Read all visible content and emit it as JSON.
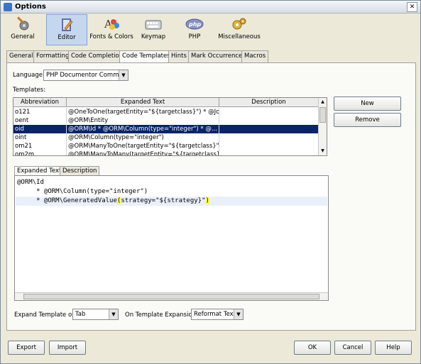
{
  "window": {
    "title": "Options",
    "close_glyph": "✕"
  },
  "categories": [
    {
      "label": "General",
      "icon": "wrench-gear-icon"
    },
    {
      "label": "Editor",
      "icon": "editor-pencil-icon",
      "selected": true
    },
    {
      "label": "Fonts & Colors",
      "icon": "fonts-colors-icon"
    },
    {
      "label": "Keymap",
      "icon": "keyboard-icon"
    },
    {
      "label": "PHP",
      "icon": "php-icon"
    },
    {
      "label": "Miscellaneous",
      "icon": "misc-gears-icon"
    }
  ],
  "tabs": [
    "General",
    "Formatting",
    "Code Completion",
    "Code Templates",
    "Hints",
    "Mark Occurrences",
    "Macros"
  ],
  "active_tab": "Code Templates",
  "language": {
    "label": "Language:",
    "value": "PHP Documentor Comment"
  },
  "templates_label": "Templates:",
  "table": {
    "columns": [
      "Abbreviation",
      "Expanded Text",
      "Description"
    ],
    "rows": [
      {
        "abbr": "o121",
        "text": "@OneToOne(targetEntity=\"${targetclass}\")   * @Join...",
        "desc": ""
      },
      {
        "abbr": "oent",
        "text": "@ORM\\Entity",
        "desc": ""
      },
      {
        "abbr": "oid",
        "text": "@ORM\\Id     * @ORM\\Column(type=\"integer\")     * @...",
        "desc": "",
        "selected": true
      },
      {
        "abbr": "oint",
        "text": "@ORM\\Column(type=\"integer\")",
        "desc": ""
      },
      {
        "abbr": "om21",
        "text": "@ORM\\ManyToOne(targetEntity=\"${targetclass}\")      ...",
        "desc": ""
      },
      {
        "abbr": "om2m",
        "text": "@ORM\\ManyToMany(targetEntity=\"${targetclass}\", invers...",
        "desc": ""
      }
    ]
  },
  "side_buttons": {
    "new": "New",
    "remove": "Remove"
  },
  "subtabs": [
    "Expanded Text",
    "Description"
  ],
  "editor": {
    "line1": "@ORM\\Id",
    "line2": "     * @ORM\\Column(type=\"integer\")",
    "line3_prefix": "     * @ORM\\GeneratedValue",
    "line3_paren_open": "(",
    "line3_mid": "strategy=\"${strategy}\"",
    "line3_paren_close": ")"
  },
  "expand_on": {
    "label": "Expand Template on:",
    "value": "Tab"
  },
  "on_expansion": {
    "label": "On Template Expansion:",
    "value": "Reformat Text"
  },
  "footer": {
    "export": "Export",
    "import": "Import",
    "ok": "OK",
    "cancel": "Cancel",
    "help": "Help"
  }
}
